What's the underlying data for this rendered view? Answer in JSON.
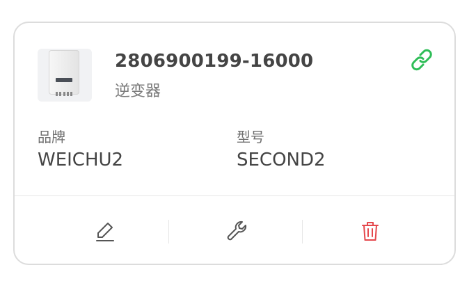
{
  "device": {
    "serial": "2806900199-16000",
    "type": "逆变器"
  },
  "fields": [
    {
      "label": "品牌",
      "value": "WEICHU2"
    },
    {
      "label": "型号",
      "value": "SECOND2"
    }
  ],
  "icons": {
    "link": "link-icon",
    "edit": "edit-icon",
    "settings": "wrench-icon",
    "delete": "trash-icon"
  },
  "colors": {
    "link": "#2ebd57",
    "delete": "#e5484d",
    "icon": "#555555"
  }
}
